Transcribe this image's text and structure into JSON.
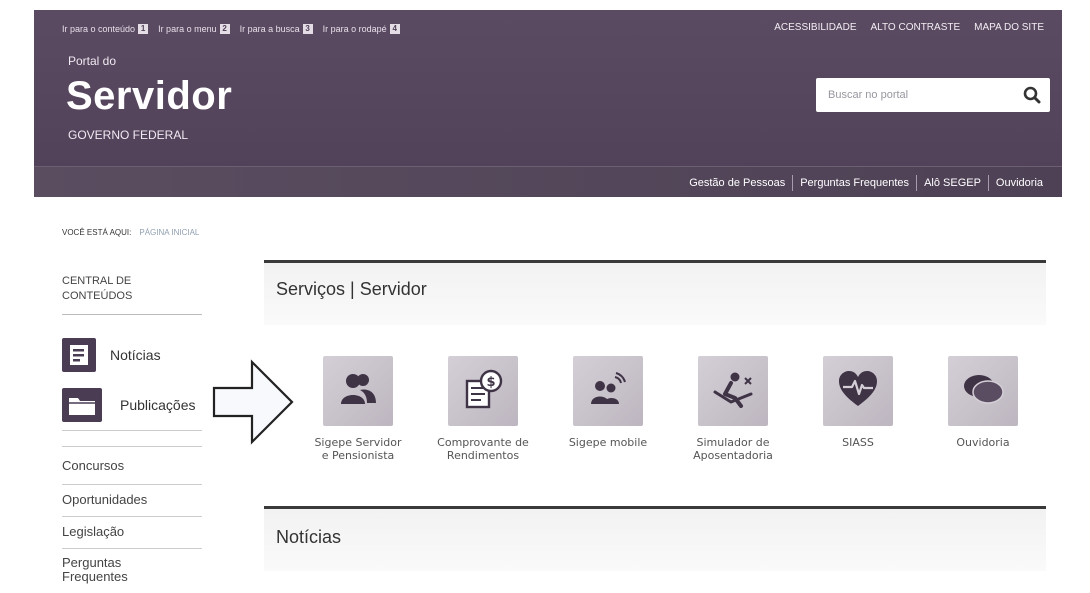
{
  "header": {
    "skip_links": [
      {
        "label": "Ir para o conteúdo",
        "key": "1"
      },
      {
        "label": "Ir para o menu",
        "key": "2"
      },
      {
        "label": "Ir para a busca",
        "key": "3"
      },
      {
        "label": "Ir para o rodapé",
        "key": "4"
      }
    ],
    "top_links": [
      "ACESSIBILIDADE",
      "ALTO CONTRASTE",
      "MAPA DO SITE"
    ],
    "portal_prefix": "Portal do",
    "brand": "Servidor",
    "subtitle": "GOVERNO FEDERAL",
    "search": {
      "placeholder": "Buscar no portal",
      "icon": "search-icon"
    },
    "nav": [
      "Gestão de Pessoas",
      "Perguntas Frequentes",
      "Alô SEGEP",
      "Ouvidoria"
    ]
  },
  "breadcrumb": {
    "label": "VOCÊ ESTÁ AQUI:",
    "current": "PÁGINA INICIAL"
  },
  "sidebar": {
    "title_line1": "CENTRAL DE",
    "title_line2": "CONTEÚDOS",
    "features": [
      {
        "label": "Notícias",
        "icon": "news-icon"
      },
      {
        "label": "Publicações",
        "icon": "folder-icon"
      }
    ],
    "links": [
      "Concursos",
      "Oportunidades",
      "Legislação",
      "Perguntas",
      "Frequentes"
    ]
  },
  "services_section": {
    "title": "Serviços | Servidor"
  },
  "services": [
    {
      "line1": "Sigepe Servidor",
      "line2": "e Pensionista",
      "icon": "users-icon"
    },
    {
      "line1": "Comprovante de",
      "line2": "Rendimentos",
      "icon": "receipt-icon"
    },
    {
      "line1": "Sigepe mobile",
      "line2": "",
      "icon": "mobile-users-icon"
    },
    {
      "line1": "Simulador de",
      "line2": "Aposentadoria",
      "icon": "lounge-chair-icon"
    },
    {
      "line1": "SIASS",
      "line2": "",
      "icon": "heart-pulse-icon"
    },
    {
      "line1": "Ouvidoria",
      "line2": "",
      "icon": "speech-bubbles-icon"
    }
  ],
  "news_section": {
    "title": "Notícias"
  },
  "colors": {
    "header": "#54445c",
    "tile": "#c9c3cc",
    "icon": "#3f3346"
  }
}
